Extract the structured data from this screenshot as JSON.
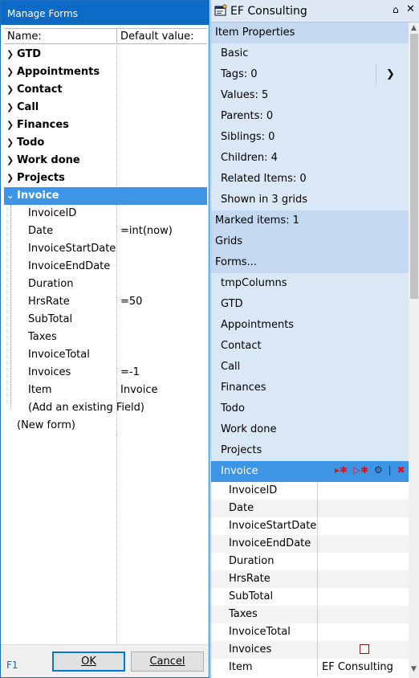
{
  "manage_forms": {
    "title": "Manage Forms",
    "columns": {
      "name": "Name:",
      "default_value": "Default value:"
    },
    "forms": [
      {
        "label": "GTD"
      },
      {
        "label": "Appointments"
      },
      {
        "label": "Contact"
      },
      {
        "label": "Call"
      },
      {
        "label": "Finances"
      },
      {
        "label": "Todo"
      },
      {
        "label": "Work done"
      },
      {
        "label": "Projects"
      },
      {
        "label": "Invoice",
        "selected": true
      }
    ],
    "invoice_fields": [
      {
        "name": "InvoiceID",
        "default": ""
      },
      {
        "name": "Date",
        "default": "=int(now)"
      },
      {
        "name": "InvoiceStartDate",
        "default": ""
      },
      {
        "name": "InvoiceEndDate",
        "default": ""
      },
      {
        "name": "Duration",
        "default": ""
      },
      {
        "name": "HrsRate",
        "default": "=50"
      },
      {
        "name": "SubTotal",
        "default": ""
      },
      {
        "name": "Taxes",
        "default": ""
      },
      {
        "name": "InvoiceTotal",
        "default": ""
      },
      {
        "name": "Invoices",
        "default": "=-1"
      },
      {
        "name": "Item",
        "default": "Invoice"
      }
    ],
    "add_existing_field": "(Add an existing Field)",
    "new_form": "(New form)",
    "help_key": "F1",
    "ok_label": "OK",
    "cancel_label": "Cancel"
  },
  "ef_consulting": {
    "title": "EF Consulting",
    "item_properties_header": "Item Properties",
    "properties": {
      "basic": "Basic",
      "tags": "Tags: 0",
      "values": "Values: 5",
      "parents": "Parents: 0",
      "siblings": "Siblings: 0",
      "children": "Children: 4",
      "related": "Related Items: 0",
      "shown_in": "Shown in 3 grids"
    },
    "marked_items_header": "Marked items: 1",
    "grids_header": "Grids",
    "forms_header": "Forms...",
    "forms_list": [
      "tmpColumns",
      "GTD",
      "Appointments",
      "Contact",
      "Call",
      "Finances",
      "Todo",
      "Work done",
      "Projects"
    ],
    "selected_form": "Invoice",
    "form_fields": [
      {
        "name": "InvoiceID",
        "value": ""
      },
      {
        "name": "Date",
        "value": ""
      },
      {
        "name": "InvoiceStartDate",
        "value": ""
      },
      {
        "name": "InvoiceEndDate",
        "value": ""
      },
      {
        "name": "Duration",
        "value": ""
      },
      {
        "name": "HrsRate",
        "value": ""
      },
      {
        "name": "SubTotal",
        "value": ""
      },
      {
        "name": "Taxes",
        "value": ""
      },
      {
        "name": "InvoiceTotal",
        "value": ""
      },
      {
        "name": "Invoices",
        "value": ""
      },
      {
        "name": "Item",
        "value": "EF Consulting"
      }
    ],
    "colors": {
      "panel_bg": "#dae7f5",
      "section_bg": "#c4d8ef",
      "selection": "#3f95e5",
      "titlebar": "#0e6ac7"
    }
  }
}
